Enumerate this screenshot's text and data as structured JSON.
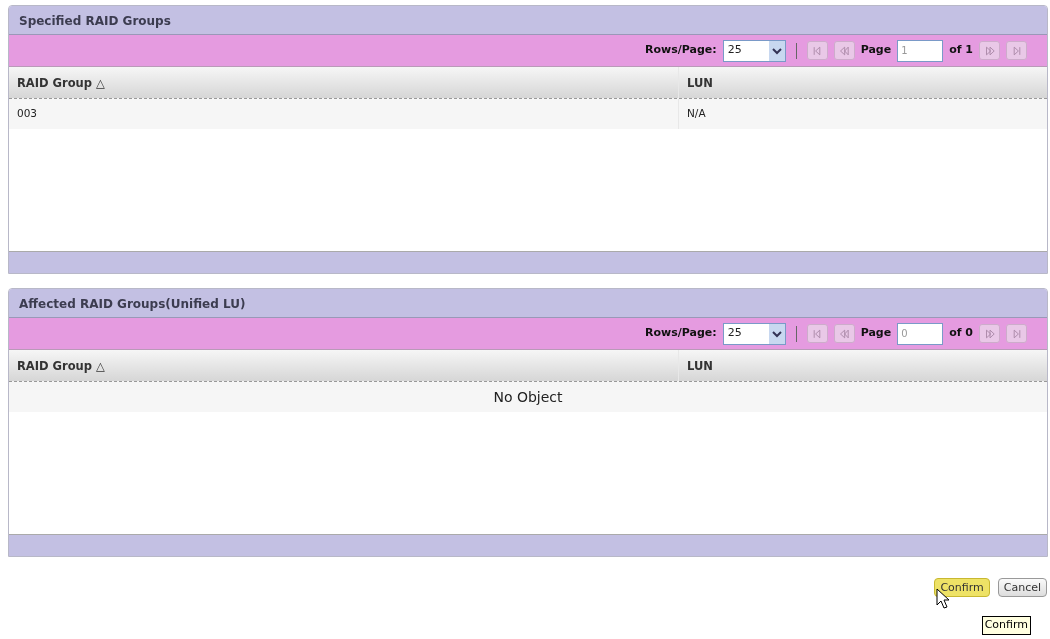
{
  "panels": [
    {
      "title": "Specified RAID Groups",
      "pager": {
        "rows_label": "Rows/Page:",
        "rows_value": "25",
        "page_label": "Page",
        "page_value": "1",
        "of_label": "of 1",
        "nav_disabled": true
      },
      "columns": [
        {
          "label": "RAID Group",
          "sort_icon": "△"
        },
        {
          "label": "LUN"
        }
      ],
      "rows": [
        [
          "003",
          "N/A"
        ]
      ]
    },
    {
      "title": "Affected RAID Groups(Unified LU)",
      "pager": {
        "rows_label": "Rows/Page:",
        "rows_value": "25",
        "page_label": "Page",
        "page_value": "0",
        "of_label": "of 0",
        "nav_disabled": true
      },
      "columns": [
        {
          "label": "RAID Group",
          "sort_icon": "△"
        },
        {
          "label": "LUN"
        }
      ],
      "empty_text": "No Object"
    }
  ],
  "buttons": [
    {
      "label": "Confirm",
      "highlighted": true
    },
    {
      "label": "Cancel",
      "highlighted": false
    }
  ],
  "tooltip": "Confirm"
}
